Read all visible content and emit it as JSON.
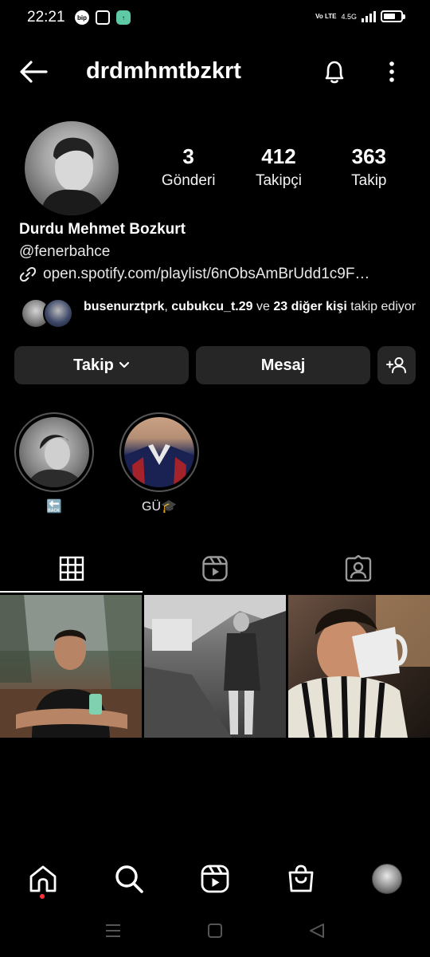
{
  "status_bar": {
    "time": "22:21",
    "app_icons": [
      "bip",
      "instagram",
      "upward-arrow-app",
      "emoji-face"
    ],
    "volte": "Vo LTE",
    "network": "4.5G",
    "signal_bars": 4,
    "battery_level": 0.7
  },
  "header": {
    "username": "drdmhmtbzkrt",
    "icons": [
      "back-arrow-icon",
      "bell-icon",
      "more-vertical-icon"
    ]
  },
  "profile": {
    "stats": [
      {
        "value": "3",
        "label": "Gönderi"
      },
      {
        "value": "412",
        "label": "Takipçi"
      },
      {
        "value": "363",
        "label": "Takip"
      }
    ],
    "full_name": "Durdu Mehmet Bozkurt",
    "bio": "@fenerbahce",
    "link": "open.spotify.com/playlist/6nObsAmBrUdd1c9F…",
    "followed_by": {
      "user1": "busenurztprk",
      "sep": ",",
      "user2": "cubukcu_t.29",
      "and": "ve",
      "others": "23 diğer kişi",
      "suffix": "takip ediyor"
    }
  },
  "actions": {
    "follow_label": "Takip",
    "message_label": "Mesaj"
  },
  "highlights": [
    {
      "label": "🔙"
    },
    {
      "label": "GÜ🎓"
    }
  ],
  "tabs": [
    "grid-icon",
    "reels-icon",
    "tagged-icon"
  ],
  "posts": 3,
  "bottom_nav": [
    "home-icon",
    "search-icon",
    "reels-icon",
    "shop-icon",
    "profile-avatar"
  ],
  "colors": {
    "background": "#000000",
    "button": "#262626",
    "notification_dot": "#ff3040"
  }
}
